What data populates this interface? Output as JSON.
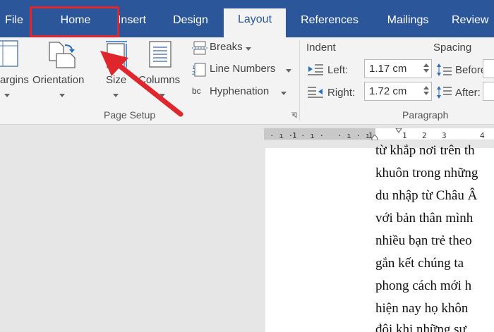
{
  "tabs": {
    "file": "File",
    "home": "Home",
    "insert": "Insert",
    "design": "Design",
    "layout": "Layout",
    "references": "References",
    "mailings": "Mailings",
    "review": "Review"
  },
  "page_setup": {
    "margins": "argins",
    "orientation": "Orientation",
    "size": "Size",
    "columns": "Columns",
    "breaks": "Breaks",
    "line_numbers": "Line Numbers",
    "hyphenation": "Hyphenation",
    "hyphenation_icon": "bc",
    "group_label": "Page Setup"
  },
  "paragraph": {
    "indent_label": "Indent",
    "spacing_label": "Spacing",
    "left_label": "Left:",
    "left_value": "1.17 cm",
    "right_label": "Right:",
    "right_value": "1.72 cm",
    "before_label": "Before:",
    "after_label": "After:",
    "group_label": "Paragraph"
  },
  "ruler": {
    "marks": [
      "1",
      "1",
      "1",
      "2",
      "3",
      "4"
    ]
  },
  "document": {
    "lines": [
      "từ khắp nơi trên th",
      "khuôn trong những",
      "du nhập từ Châu Â",
      "với bản thân mình",
      "nhiều bạn trẻ theo",
      "gắn kết chúng ta",
      "phong cách mới h",
      "hiện nay họ khôn",
      "đôi khi những sự"
    ]
  },
  "colors": {
    "accent": "#2b579a",
    "highlight": "#e0262c"
  },
  "icons": [
    "margins-icon",
    "orientation-icon",
    "size-icon",
    "columns-icon",
    "breaks-icon",
    "line-numbers-icon",
    "hyphenation-icon",
    "indent-left-icon",
    "indent-right-icon",
    "spacing-before-icon",
    "spacing-after-icon",
    "dialog-launcher-icon"
  ]
}
